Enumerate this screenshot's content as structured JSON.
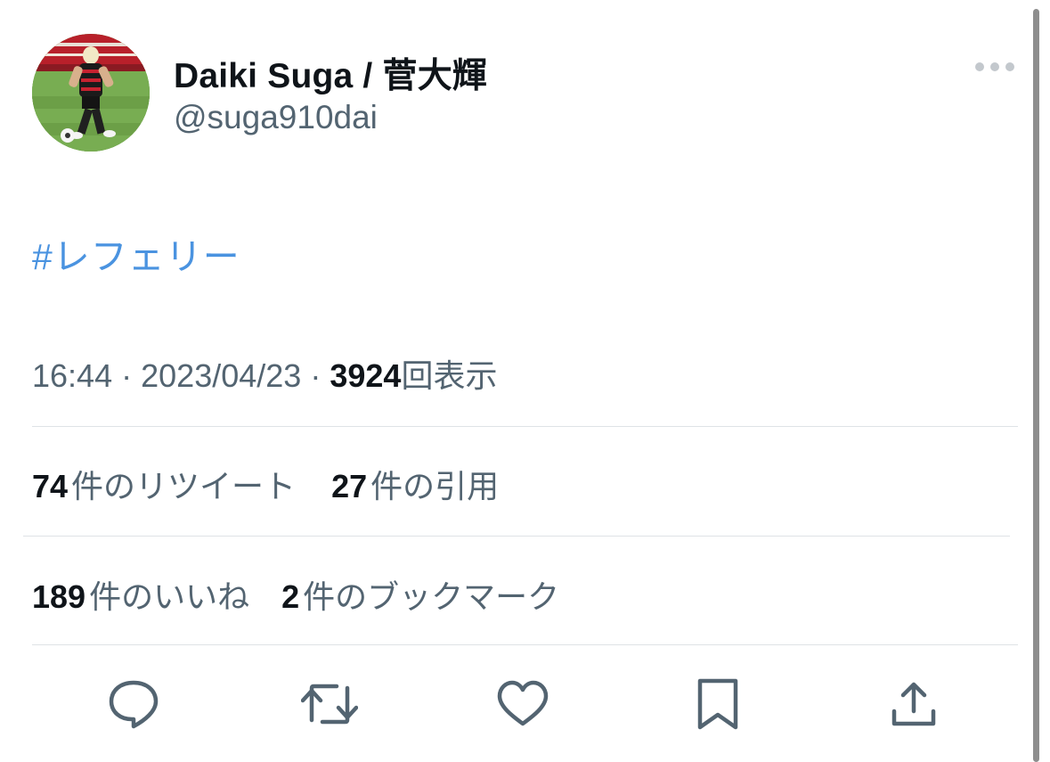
{
  "tweet": {
    "author": {
      "display_name": "Daiki Suga / 菅大輝",
      "handle": "@suga910dai"
    },
    "text": "#レフェリー",
    "time": "16:44",
    "separator": "·",
    "date": "2023/04/23",
    "views_count": "3924",
    "views_label": "回表示"
  },
  "stats": {
    "retweets": {
      "count": "74",
      "label": "件のリツイート"
    },
    "quotes": {
      "count": "27",
      "label": "件の引用"
    },
    "likes": {
      "count": "189",
      "label": "件のいいね"
    },
    "bookmarks": {
      "count": "2",
      "label": "件のブックマーク"
    }
  },
  "icons": {
    "more": "more-dots-icon",
    "reply": "reply-bubble-icon",
    "retweet": "retweet-arrows-icon",
    "like": "heart-icon",
    "bookmark": "bookmark-icon",
    "share": "share-upload-icon"
  },
  "colors": {
    "text_primary": "#0f1419",
    "text_secondary": "#536471",
    "link": "#4a93e0",
    "divider": "#dfe3e6",
    "more_dots": "#c3c8cd"
  }
}
